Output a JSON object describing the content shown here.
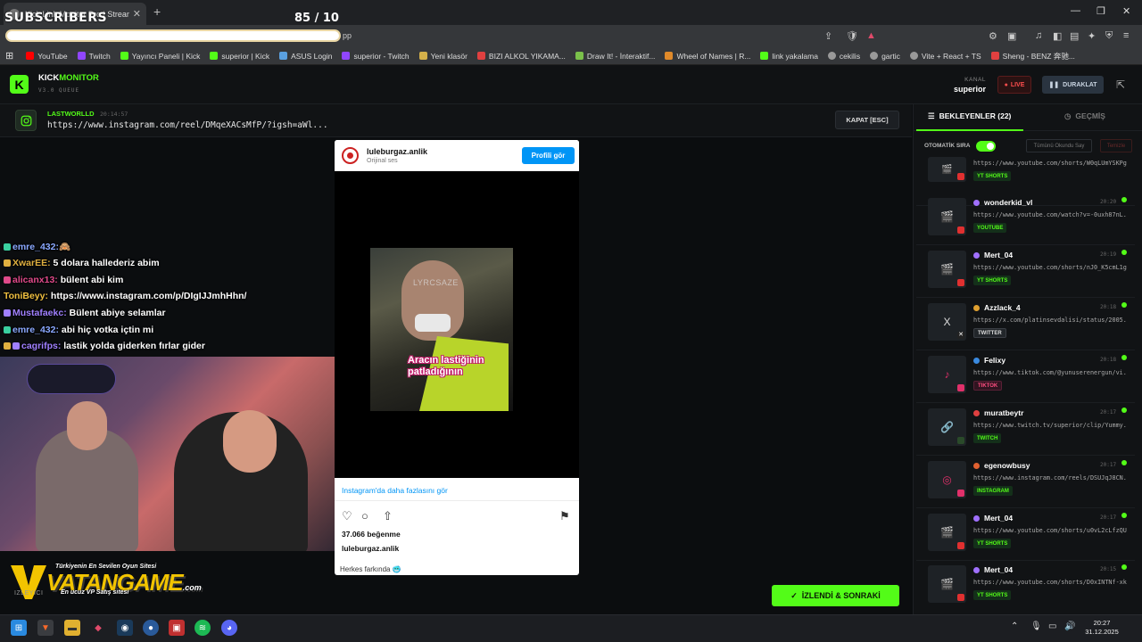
{
  "browser": {
    "tab_title": "Kick Link Monitor Pro | Stream",
    "new_tab": "+",
    "address_tail": "pp",
    "bookmarks": [
      {
        "label": "YouTube",
        "color": "#ff0000"
      },
      {
        "label": "Twitch",
        "color": "#9146ff"
      },
      {
        "label": "Yayıncı Paneli | Kick",
        "color": "#53fc18"
      },
      {
        "label": "superior | Kick",
        "color": "#53fc18"
      },
      {
        "label": "ASUS Login",
        "color": "#5aa0e0"
      },
      {
        "label": "superior - Twitch",
        "color": "#9146ff"
      },
      {
        "label": "Yeni klasör",
        "color": "#d4b04a"
      },
      {
        "label": "BIZI ALKOL YIKAMA...",
        "color": "#e04040"
      },
      {
        "label": "Draw It! - İnteraktif...",
        "color": "#7ac04a"
      },
      {
        "label": "Wheel of Names | R...",
        "color": "#e08a2a"
      },
      {
        "label": "link yakalama",
        "color": "#53fc18"
      },
      {
        "label": "cekilis",
        "color": "#cccccc"
      },
      {
        "label": "gartic",
        "color": "#cccccc"
      },
      {
        "label": "Vite + React + TS",
        "color": "#a070ff"
      },
      {
        "label": "Sheng - BENZ 奔驰...",
        "color": "#e04040"
      }
    ]
  },
  "overlay": {
    "subscribers": "SUBSCRIBERS",
    "count": "85  / 10"
  },
  "app": {
    "logo_letter": "K",
    "brand_part1": "KICK",
    "brand_part2": "MONITOR",
    "version": "V3.0 QUEUE",
    "kanal_label": "KANAL",
    "kanal_name": "superior",
    "live_label": "LIVE",
    "pause_label": "DURAKLAT",
    "accent": "#53fc18"
  },
  "current": {
    "user": "LASTWORLLD",
    "time": "20:14:57",
    "url": "https://www.instagram.com/reel/DMqeXACsMfP/?igsh=aWl...",
    "close_label": "KAPAT [ESC]"
  },
  "chat": [
    {
      "user": "emre_432:",
      "msg": "🙈",
      "color": "#8aa8ff"
    },
    {
      "user": "XwarEE:",
      "msg": "5 dolara hallederiz abim",
      "color": "#e0b040"
    },
    {
      "user": "alicanx13:",
      "msg": "bülent abi kim",
      "color": "#e04a8a"
    },
    {
      "user": "ToniBeyy:",
      "msg": "https://www.instagram.com/p/DIgIJJmhHhn/",
      "color": "#f0c040"
    },
    {
      "user": "Mustafaekc:",
      "msg": "Bülent abiye selamlar",
      "color": "#a080ff"
    },
    {
      "user": "emre_432:",
      "msg": "abi hiç votka içtin mi",
      "color": "#8aa8ff"
    },
    {
      "user": "cagrifps:",
      "msg": "lastik yolda giderken fırlar gider",
      "color": "#a080ff"
    }
  ],
  "banner": {
    "tag1": "Türkiyenin En Sevilen Oyun Sitesi",
    "brand": "VATANGAME",
    "tag2": "En ucuz VP Satış sitesi",
    "com": ".com",
    "izleyici": "IZLEYICI"
  },
  "embed": {
    "username": "luleburgaz.anlik",
    "sub": "Orijinal ses",
    "profile_btn": "Profili gör",
    "watermark": "LYRCSAZE",
    "caption_line1": "Aracın lastiğinin",
    "caption_line2": "patladığının",
    "more": "Instagram'da daha fazlasını gör",
    "likes": "37.066 beğenme",
    "username2": "luleburgaz.anlik",
    "caption": "Herkes farkında 🥶"
  },
  "watched_btn": "İZLENDİ & SONRAKİ",
  "panel": {
    "tab_waiting": "BEKLEYENLER (22)",
    "tab_history": "GEÇMİŞ",
    "auto_label": "OTOMATİK SIRA",
    "all_read": "Tümünü Okundu Say",
    "clear": "Temizle",
    "queue": [
      {
        "user": "",
        "time": "",
        "url": "https://www.youtube.com/shorts/W0qLUmYSKPg",
        "tag": "YT SHORTS",
        "platform": "youtube",
        "thumb": "🎬"
      },
      {
        "user": "wonderkid_vl",
        "time": "20:20",
        "url": "https://www.youtube.com/watch?v=-0uxh87nL...",
        "tag": "YOUTUBE",
        "platform": "youtube",
        "thumb": "🎬"
      },
      {
        "user": "Mert_04",
        "time": "20:19",
        "url": "https://www.youtube.com/shorts/nJ0_K5cmL1g",
        "tag": "YT SHORTS",
        "platform": "youtube",
        "thumb": "🎬"
      },
      {
        "user": "Azzlack_4",
        "time": "20:18",
        "url": "https://x.com/platinsevdalisi/status/2005...",
        "tag": "TWITTER",
        "platform": "twitter",
        "thumb": "X"
      },
      {
        "user": "Felixy",
        "time": "20:18",
        "url": "https://www.tiktok.com/@yunuserenergun/vi...",
        "tag": "TIKTOK",
        "platform": "tiktok",
        "thumb": "♪"
      },
      {
        "user": "muratbeytr",
        "time": "20:17",
        "url": "https://www.twitch.tv/superior/clip/Yummy...",
        "tag": "TWITCH",
        "platform": "twitch",
        "thumb": "🔗"
      },
      {
        "user": "egenowbusy",
        "time": "20:17",
        "url": "https://www.instagram.com/reels/DSUJqJ8CN...",
        "tag": "INSTAGRAM",
        "platform": "instagram",
        "thumb": "◎"
      },
      {
        "user": "Mert_04",
        "time": "20:17",
        "url": "https://www.youtube.com/shorts/u0vL2cLfzQU",
        "tag": "YT SHORTS",
        "platform": "youtube",
        "thumb": "🎬"
      },
      {
        "user": "Mert_04",
        "time": "20:15",
        "url": "https://www.youtube.com/shorts/D0xINTNf-xk",
        "tag": "YT SHORTS",
        "platform": "youtube",
        "thumb": "🎬"
      }
    ]
  },
  "taskbar": {
    "time": "20:27",
    "date": "31.12.2025"
  }
}
